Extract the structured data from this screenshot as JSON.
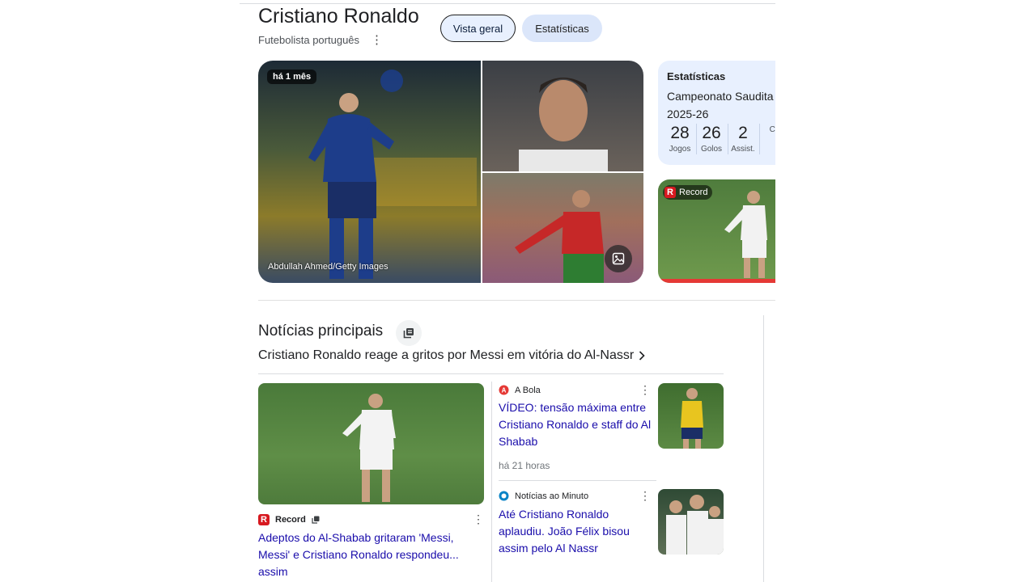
{
  "entity": {
    "title": "Cristiano Ronaldo",
    "subtitle": "Futebolista português"
  },
  "tabs": [
    {
      "label": "Vista geral",
      "active": true
    },
    {
      "label": "Estatísticas",
      "active": false
    }
  ],
  "gallery": {
    "time_badge": "há 1 mês",
    "credit": "Abdullah Ahmed/Getty Images"
  },
  "stats": {
    "title": "Estatísticas",
    "competition": "Campeonato Saudita",
    "season": "2025-26",
    "items": [
      {
        "value": "28",
        "label": "Jogos"
      },
      {
        "value": "26",
        "label": "Golos"
      },
      {
        "value": "2",
        "label": "Assist."
      },
      {
        "value": "",
        "label": "Ca"
      }
    ]
  },
  "video_card": {
    "source": "Record"
  },
  "news": {
    "heading": "Notícias principais",
    "headline": "Cristiano Ronaldo reage a gritos por Messi em vitória do Al-Nassr",
    "main_story": {
      "source": "Record",
      "title": "Adeptos do Al-Shabab gritaram 'Messi, Messi' e Cristiano Ronaldo respondeu... assim"
    },
    "side_stories": [
      {
        "source": "A Bola",
        "title": "VÍDEO: tensão máxima entre Cristiano Ronaldo e staff do Al Shabab",
        "time": "há 21 horas"
      },
      {
        "source": "Notícias ao Minuto",
        "title": "Até Cristiano Ronaldo aplaudiu. João Félix bisou assim pelo Al Nassr"
      }
    ]
  },
  "colors": {
    "link": "#1a0dab",
    "record_red": "#d71920",
    "stats_bg": "#e8f0fe"
  }
}
